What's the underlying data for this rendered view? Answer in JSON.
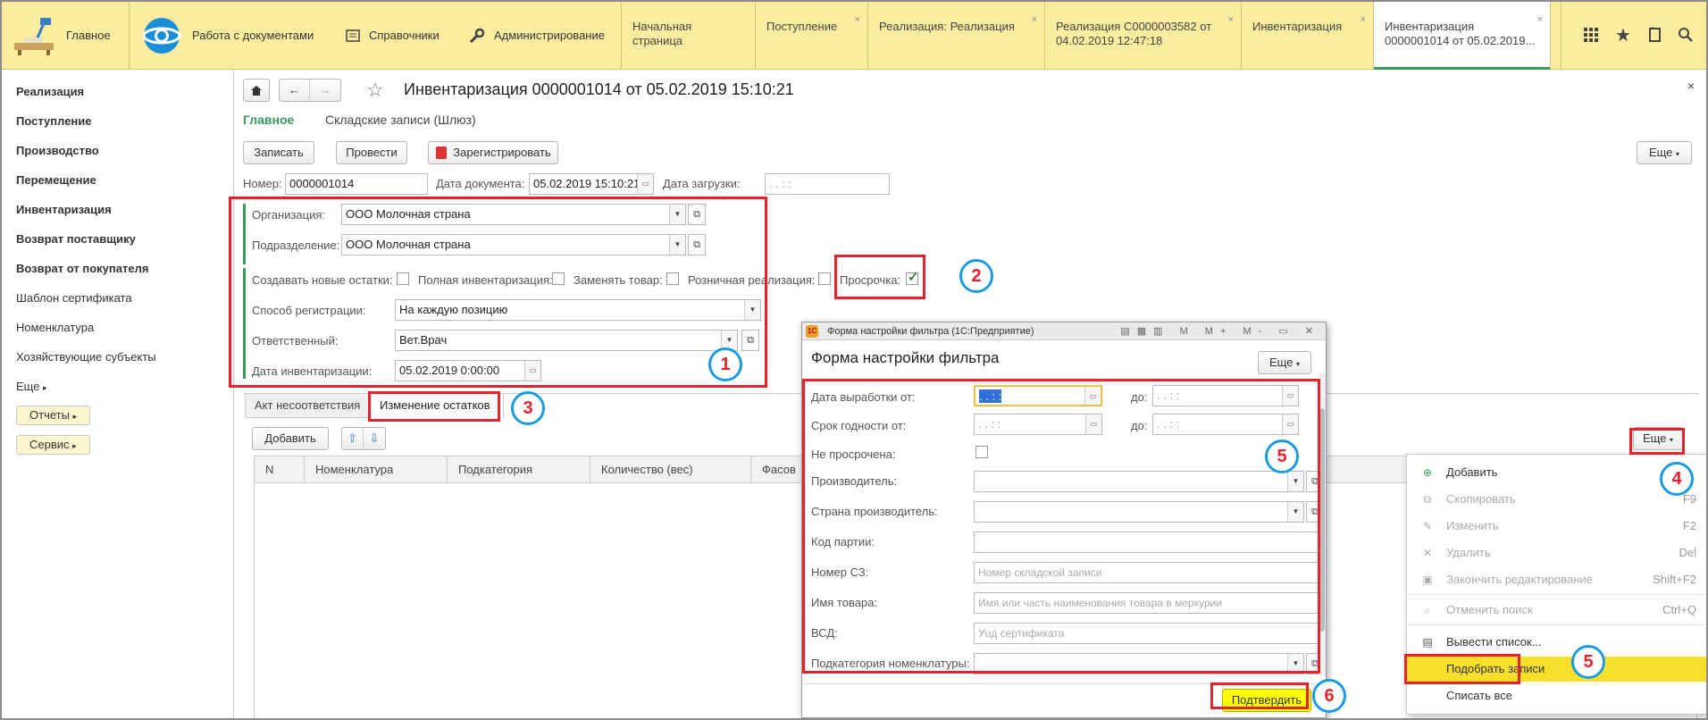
{
  "topbar": {
    "home_label": "Главное",
    "docs_label": "Работа с документами",
    "refs_label": "Справочники",
    "admin_label": "Администрирование",
    "tabs": [
      {
        "label": "Начальная страница"
      },
      {
        "label": "Поступление"
      },
      {
        "label": "Реализация: Реализация"
      },
      {
        "label": "Реализация С0000003582 от 04.02.2019 12:47:18"
      },
      {
        "label": "Инвентаризация"
      },
      {
        "label": "Инвентаризация 0000001014 от 05.02.2019..."
      }
    ],
    "close_glyph": "×"
  },
  "sidebar": {
    "items": [
      {
        "label": "Реализация"
      },
      {
        "label": "Поступление"
      },
      {
        "label": "Производство"
      },
      {
        "label": "Перемещение"
      },
      {
        "label": "Инвентаризация"
      },
      {
        "label": "Возврат поставщику"
      },
      {
        "label": "Возврат от покупателя"
      },
      {
        "label": "Шаблон сертификата"
      },
      {
        "label": "Номенклатура"
      },
      {
        "label": "Хозяйствующие субъекты"
      },
      {
        "label": "Еще"
      }
    ],
    "reports_label": "Отчеты",
    "service_label": "Сервис"
  },
  "doc": {
    "title": "Инвентаризация 0000001014 от 05.02.2019 15:10:21",
    "nav_main": "Главное",
    "nav_records": "Складские записи (Шлюз)",
    "btn_save": "Записать",
    "btn_post": "Провести",
    "btn_register": "Зарегистрировать",
    "btn_more": "Еще",
    "number_label": "Номер:",
    "number_value": "0000001014",
    "date_label": "Дата документа:",
    "date_value": "05.02.2019 15:10:21",
    "load_label": "Дата загрузки:",
    "load_value": " .  .      :  :",
    "org_label": "Организация:",
    "org_value": "ООО Молочная страна",
    "dept_label": "Подразделение:",
    "dept_value": "ООО Молочная страна",
    "cb_new_label": "Создавать новые остатки:",
    "cb_full_label": "Полная инвентаризация:",
    "cb_replace_label": "Заменять товар:",
    "cb_retail_label": "Розничная реализация:",
    "cb_expired_label": "Просрочка:",
    "method_label": "Способ регистрации:",
    "method_value": "На каждую позицию",
    "resp_label": "Ответственный:",
    "resp_value": "Вет.Врач",
    "invdate_label": "Дата инвентаризации:",
    "invdate_value": "05.02.2019  0:00:00",
    "tab_act": "Акт несоответствия",
    "tab_changes": "Изменение остатков",
    "btn_add": "Добавить",
    "btn_more2": "Еще",
    "columns": [
      "N",
      "Номенклатура",
      "Подкатегория",
      "Количество (вес)",
      "Фасов"
    ]
  },
  "dialog": {
    "window_title": "Форма настройки фильтра  (1С:Предприятие)",
    "heading": "Форма настройки фильтра",
    "more": "Еще",
    "prod_date_label": "Дата выработки от:",
    "prod_from": " .  .      :  :",
    "to_label": "до:",
    "prod_to": " .  .      :  :",
    "exp_label": "Срок годности от:",
    "exp_from": " .  .      :  :",
    "exp_to": " .  .      :  :",
    "not_expired_label": "Не просрочена:",
    "maker_label": "Производитель:",
    "country_label": "Страна производитель:",
    "batch_label": "Код партии:",
    "sz_label": "Номер СЗ:",
    "sz_placeholder": "Номер складской записи",
    "name_label": "Имя товара:",
    "name_placeholder": "Имя или часть наименования товара в меркурии",
    "vsd_label": "ВСД:",
    "vsd_placeholder": "Уuд сертификата",
    "subcat_label": "Подкатегория номенклатуры:",
    "confirm": "Подтвердить"
  },
  "menu": {
    "items": [
      {
        "label": "Добавить",
        "key": ""
      },
      {
        "label": "Скопировать",
        "key": "F9"
      },
      {
        "label": "Изменить",
        "key": "F2"
      },
      {
        "label": "Удалить",
        "key": "Del"
      },
      {
        "label": "Закончить редактирование",
        "key": "Shift+F2"
      },
      {
        "label": "Отменить поиск",
        "key": "Ctrl+Q"
      },
      {
        "label": "Вывести список...",
        "key": ""
      },
      {
        "label": "Подобрать записи",
        "key": ""
      },
      {
        "label": "Списать все",
        "key": ""
      }
    ]
  },
  "markers": [
    "1",
    "2",
    "3",
    "4",
    "5",
    "5",
    "6"
  ],
  "colors": {
    "topbar": "#fbeda0",
    "accent_green": "#3a9b5c",
    "annotation_red": "#e8222a",
    "annotation_blue": "#1a9be0",
    "highlight": "#ffff00"
  }
}
